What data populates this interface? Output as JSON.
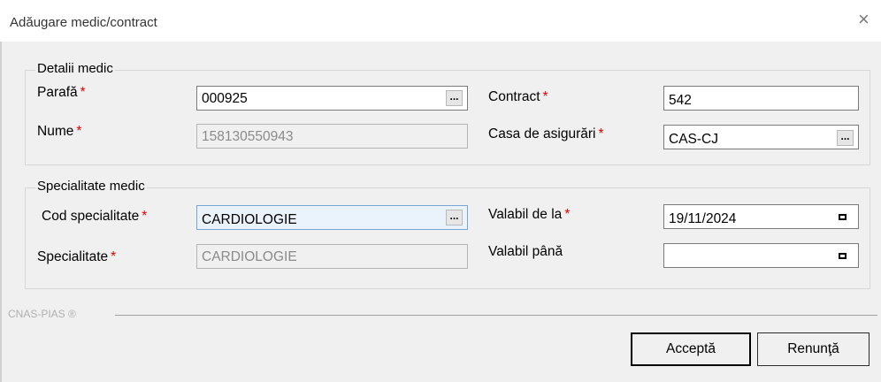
{
  "window": {
    "title": "Adăugare medic/contract",
    "close_glyph": "×"
  },
  "detalii": {
    "legend": "Detalii medic",
    "parafa": {
      "label": "Parafă",
      "value": "000925"
    },
    "nume": {
      "label": "Nume",
      "value": "158130550943"
    },
    "contract": {
      "label": "Contract",
      "value": "542"
    },
    "casa": {
      "label": "Casa de asigurări",
      "value": "CAS-CJ"
    }
  },
  "specialitate": {
    "legend": "Specialitate medic",
    "cod": {
      "label": "Cod specialitate",
      "value": "CARDIOLOGIE"
    },
    "spec": {
      "label": "Specialitate",
      "value": "CARDIOLOGIE"
    },
    "valabil_de_la": {
      "label": "Valabil de la",
      "value": "19/11/2024"
    },
    "valabil_pana": {
      "label": "Valabil până",
      "value": ""
    }
  },
  "required_mark": "*",
  "ellipsis": "...",
  "footer": {
    "brand": "CNAS-PIAS ®",
    "accept": "Acceptă",
    "cancel": "Renunţă"
  },
  "colors": {
    "required": "#e00000",
    "highlight_field": "#eaf2fc",
    "background": "#f0f0f0"
  },
  "icons": [
    "close-icon",
    "ellipsis-icon",
    "calendar-icon"
  ]
}
